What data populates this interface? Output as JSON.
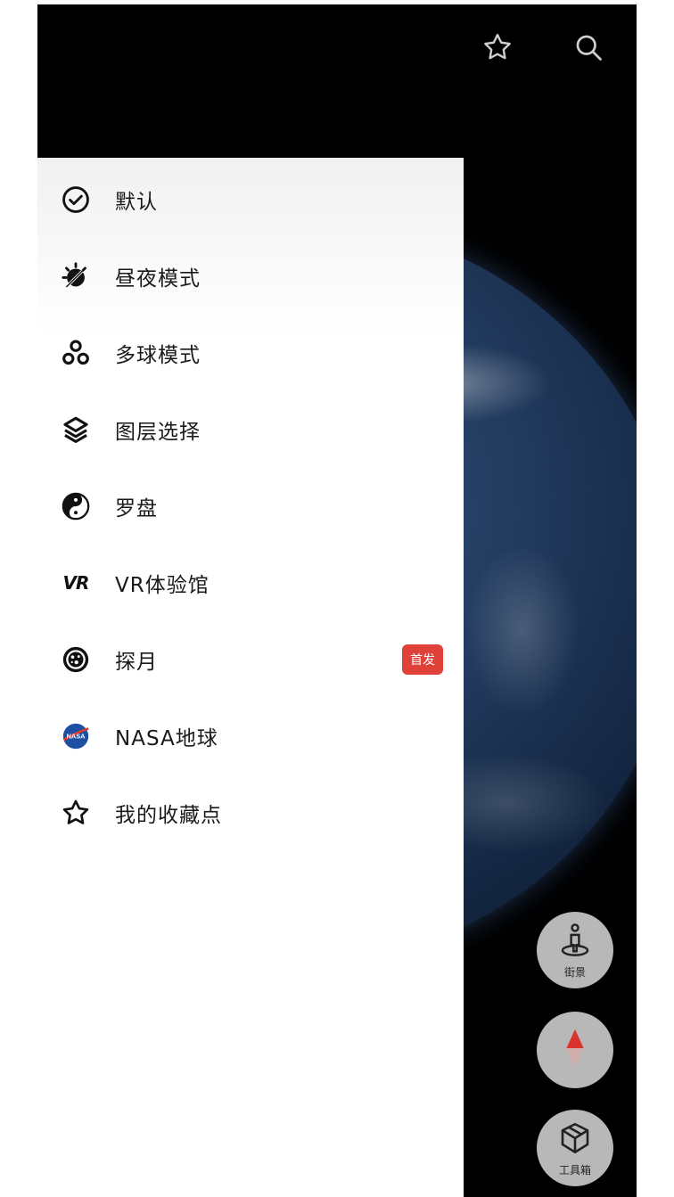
{
  "top_bar": {
    "favorite_icon": "star-outline-icon",
    "search_icon": "search-icon"
  },
  "menu": {
    "items": [
      {
        "label": "默认",
        "icon": "check-circle-icon"
      },
      {
        "label": "昼夜模式",
        "icon": "day-night-icon"
      },
      {
        "label": "多球模式",
        "icon": "multi-globe-icon"
      },
      {
        "label": "图层选择",
        "icon": "layers-icon"
      },
      {
        "label": "罗盘",
        "icon": "yin-yang-compass-icon"
      },
      {
        "label": "VR体验馆",
        "icon": "vr-icon",
        "icon_text": "VR"
      },
      {
        "label": "探月",
        "icon": "moon-icon",
        "badge": "首发"
      },
      {
        "label": "NASA地球",
        "icon": "nasa-logo-icon",
        "icon_text": "NASA"
      },
      {
        "label": "我的收藏点",
        "icon": "star-outline-icon"
      }
    ]
  },
  "fabs": {
    "street_view": {
      "label": "街景",
      "icon": "street-view-icon"
    },
    "compass": {
      "icon": "compass-needle-icon"
    },
    "toolbox": {
      "label": "工具箱",
      "icon": "cube-box-icon"
    }
  },
  "colors": {
    "badge": "#e0423a",
    "background": "#000000",
    "drawer": "#ffffff",
    "compass_needle": "#d9332b"
  }
}
